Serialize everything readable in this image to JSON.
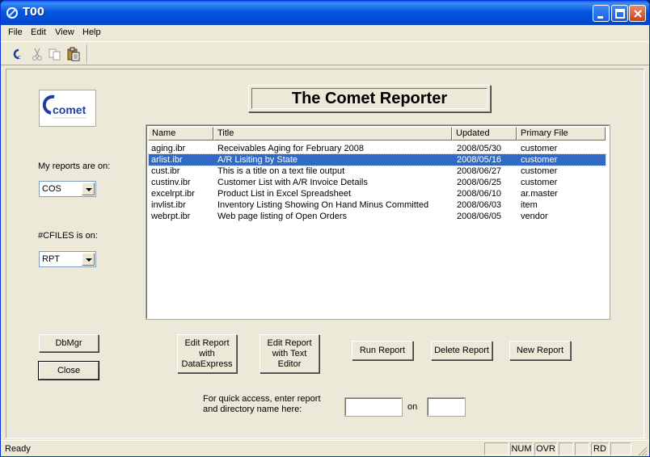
{
  "window": {
    "title": "T00"
  },
  "menu": [
    "File",
    "Edit",
    "View",
    "Help"
  ],
  "toolbar": {
    "icons": [
      "comet-icon",
      "cut-icon",
      "copy-icon",
      "paste-icon"
    ]
  },
  "logo": {
    "text": "comet"
  },
  "reports_location": {
    "label": "My reports are on:",
    "value": "COS"
  },
  "cfiles": {
    "label": "#CFILES is on:",
    "value": "RPT"
  },
  "buttons": {
    "dbmgr": "DbMgr",
    "close": "Close",
    "edit_dataexpress": [
      "Edit Report",
      "with",
      "DataExpress"
    ],
    "edit_text": [
      "Edit Report",
      "with Text",
      "Editor"
    ],
    "run": "Run Report",
    "delete": "Delete Report",
    "new": "New Report"
  },
  "banner": "The Comet Reporter",
  "table": {
    "columns": [
      "Name",
      "Title",
      "Updated",
      "Primary File"
    ],
    "rows": [
      {
        "name": "aging.ibr",
        "title": "Receivables Aging for February 2008",
        "updated": "2008/05/30",
        "file": "customer",
        "selected": false
      },
      {
        "name": "arlist.ibr",
        "title": "A/R Lisiting by State",
        "updated": "2008/05/16",
        "file": "customer",
        "selected": true
      },
      {
        "name": "cust.ibr",
        "title": "This is a title on a text file output",
        "updated": "2008/06/27",
        "file": "customer",
        "selected": false
      },
      {
        "name": "custinv.ibr",
        "title": "Customer List with A/R Invoice Details",
        "updated": "2008/06/25",
        "file": "customer",
        "selected": false
      },
      {
        "name": "excelrpt.ibr",
        "title": "Product List in Excel Spreadsheet",
        "updated": "2008/06/10",
        "file": "ar.master",
        "selected": false
      },
      {
        "name": "invlist.ibr",
        "title": "Inventory Listing Showing On Hand Minus Committed",
        "updated": "2008/06/03",
        "file": "item",
        "selected": false
      },
      {
        "name": "webrpt.ibr",
        "title": "Web page listing of Open Orders",
        "updated": "2008/06/05",
        "file": "vendor",
        "selected": false
      }
    ]
  },
  "quick_access": {
    "lines": [
      "For quick access, enter report",
      "and directory name here:"
    ],
    "on_label": "on",
    "report_value": "",
    "dir_value": ""
  },
  "status": {
    "text": "Ready",
    "panes": [
      "",
      "NUM",
      "OVR",
      "",
      "",
      "RD",
      ""
    ]
  },
  "colors": {
    "selection": "#316ac5",
    "titlebar": "#0356e0",
    "face": "#ece9d8"
  }
}
